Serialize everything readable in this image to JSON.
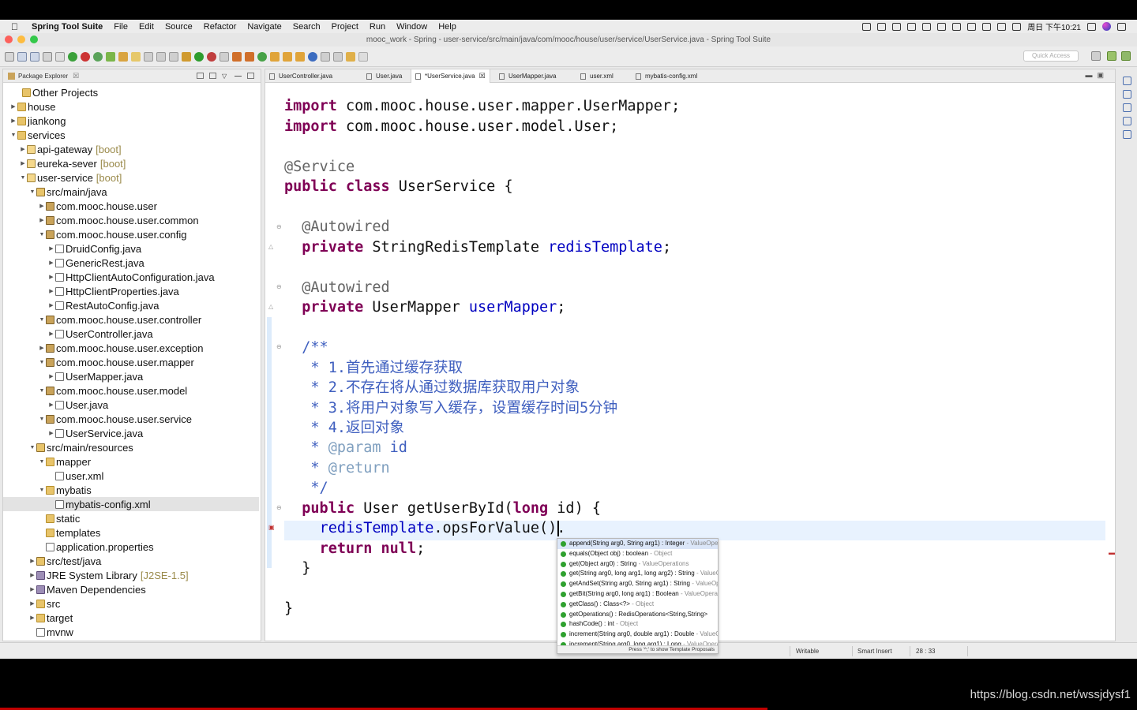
{
  "menubar": {
    "app_name": "Spring Tool Suite",
    "items": [
      "File",
      "Edit",
      "Source",
      "Refactor",
      "Navigate",
      "Search",
      "Project",
      "Run",
      "Window",
      "Help"
    ],
    "clock": "周日 下午10:21"
  },
  "window": {
    "title": "mooc_work - Spring - user-service/src/main/java/com/mooc/house/user/service/UserService.java - Spring Tool Suite"
  },
  "toolbar": {
    "quick_access_placeholder": "Quick Access"
  },
  "package_explorer": {
    "title": "Package Explorer",
    "tree": [
      {
        "label": "Other Projects",
        "deco": "",
        "icon": "folder",
        "twisty": ""
      },
      {
        "label": "house",
        "deco": "",
        "icon": "folder",
        "twisty": "▶"
      },
      {
        "label": "jiankong",
        "deco": "",
        "icon": "folder",
        "twisty": "▶"
      },
      {
        "label": "services",
        "deco": "",
        "icon": "folder",
        "twisty": "▼"
      },
      {
        "label": "api-gateway",
        "deco": "[boot]",
        "icon": "project",
        "twisty": "▶"
      },
      {
        "label": "eureka-sever",
        "deco": "[boot]",
        "icon": "project",
        "twisty": "▶"
      },
      {
        "label": "user-service",
        "deco": "[boot]",
        "icon": "project",
        "twisty": "▼"
      },
      {
        "label": "src/main/java",
        "deco": "",
        "icon": "srcf",
        "twisty": "▼"
      },
      {
        "label": "com.mooc.house.user",
        "deco": "",
        "icon": "package",
        "twisty": "▶"
      },
      {
        "label": "com.mooc.house.user.common",
        "deco": "",
        "icon": "package",
        "twisty": "▶"
      },
      {
        "label": "com.mooc.house.user.config",
        "deco": "",
        "icon": "package",
        "twisty": "▼"
      },
      {
        "label": "DruidConfig.java",
        "deco": "",
        "icon": "java",
        "twisty": "▶"
      },
      {
        "label": "GenericRest.java",
        "deco": "",
        "icon": "java",
        "twisty": "▶"
      },
      {
        "label": "HttpClientAutoConfiguration.java",
        "deco": "",
        "icon": "java",
        "twisty": "▶"
      },
      {
        "label": "HttpClientProperties.java",
        "deco": "",
        "icon": "java",
        "twisty": "▶"
      },
      {
        "label": "RestAutoConfig.java",
        "deco": "",
        "icon": "java",
        "twisty": "▶"
      },
      {
        "label": "com.mooc.house.user.controller",
        "deco": "",
        "icon": "package",
        "twisty": "▼"
      },
      {
        "label": "UserController.java",
        "deco": "",
        "icon": "java",
        "twisty": "▶"
      },
      {
        "label": "com.mooc.house.user.exception",
        "deco": "",
        "icon": "package",
        "twisty": "▶"
      },
      {
        "label": "com.mooc.house.user.mapper",
        "deco": "",
        "icon": "package",
        "twisty": "▼"
      },
      {
        "label": "UserMapper.java",
        "deco": "",
        "icon": "java",
        "twisty": "▶"
      },
      {
        "label": "com.mooc.house.user.model",
        "deco": "",
        "icon": "package",
        "twisty": "▼"
      },
      {
        "label": "User.java",
        "deco": "",
        "icon": "java",
        "twisty": "▶"
      },
      {
        "label": "com.mooc.house.user.service",
        "deco": "",
        "icon": "package",
        "twisty": "▼"
      },
      {
        "label": "UserService.java",
        "deco": "",
        "icon": "java",
        "twisty": "▶"
      },
      {
        "label": "src/main/resources",
        "deco": "",
        "icon": "srcf",
        "twisty": "▼"
      },
      {
        "label": "mapper",
        "deco": "",
        "icon": "folder",
        "twisty": "▼"
      },
      {
        "label": "user.xml",
        "deco": "",
        "icon": "xml",
        "twisty": ""
      },
      {
        "label": "mybatis",
        "deco": "",
        "icon": "folder",
        "twisty": "▼"
      },
      {
        "label": "mybatis-config.xml",
        "deco": "",
        "icon": "xml",
        "twisty": ""
      },
      {
        "label": "static",
        "deco": "",
        "icon": "folder",
        "twisty": ""
      },
      {
        "label": "templates",
        "deco": "",
        "icon": "folder",
        "twisty": ""
      },
      {
        "label": "application.properties",
        "deco": "",
        "icon": "java",
        "twisty": ""
      },
      {
        "label": "src/test/java",
        "deco": "",
        "icon": "srcf",
        "twisty": "▶"
      },
      {
        "label": "JRE System Library",
        "deco": "[J2SE-1.5]",
        "icon": "lib",
        "twisty": "▶"
      },
      {
        "label": "Maven Dependencies",
        "deco": "",
        "icon": "lib",
        "twisty": "▶"
      },
      {
        "label": "src",
        "deco": "",
        "icon": "folder",
        "twisty": "▶"
      },
      {
        "label": "target",
        "deco": "",
        "icon": "folder",
        "twisty": "▶"
      },
      {
        "label": "mvnw",
        "deco": "",
        "icon": "java",
        "twisty": ""
      }
    ]
  },
  "editor": {
    "tabs": [
      {
        "label": "UserController.java",
        "active": false
      },
      {
        "label": "User.java",
        "active": false
      },
      {
        "label": "*UserService.java",
        "active": true
      },
      {
        "label": "UserMapper.java",
        "active": false
      },
      {
        "label": "user.xml",
        "active": false
      },
      {
        "label": "mybatis-config.xml",
        "active": false
      }
    ],
    "code": {
      "import1_kw": "import",
      "import1": " com.mooc.house.user.mapper.UserMapper;",
      "import2_kw": "import",
      "import2": " com.mooc.house.user.model.User;",
      "service_ann": "@Service",
      "class_kw": "public class",
      "class_rest": " UserService {",
      "autowired1": "@Autowired",
      "private1_kw": "private",
      "private1_type": " StringRedisTemplate ",
      "private1_field": "redisTemplate",
      "private1_end": ";",
      "autowired2": "@Autowired",
      "private2_kw": "private",
      "private2_type": " UserMapper ",
      "private2_field": "userMapper",
      "private2_end": ";",
      "jdoc_open": "/**",
      "jdoc1": " * 1.首先通过缓存获取",
      "jdoc2": " * 2.不存在将从通过数据库获取用户对象",
      "jdoc3": " * 3.将用户对象写入缓存，设置缓存时间5分钟",
      "jdoc4": " * 4.返回对象",
      "jdoc_param_star": " * ",
      "jdoc_param_tag": "@param",
      "jdoc_param_name": " id",
      "jdoc_return_star": " * ",
      "jdoc_return_tag": "@return",
      "jdoc_close": " */",
      "method_kw": "public",
      "method_rest": " User getUserById(",
      "method_kw2": "long",
      "method_end": " id) {",
      "call_field": "redisTemplate",
      "call_rest": ".opsForValue().",
      "return_kw": "return",
      "return_val": " null",
      "return_end": ";",
      "close_method": "}",
      "close_class": "}"
    }
  },
  "content_assist": {
    "items": [
      {
        "sig": "append(String arg0, String arg1) : Integer",
        "owner": " - ValueOperations"
      },
      {
        "sig": "equals(Object obj) : boolean",
        "owner": " - Object"
      },
      {
        "sig": "get(Object arg0) : String",
        "owner": " - ValueOperations"
      },
      {
        "sig": "get(String arg0, long arg1, long arg2) : String",
        "owner": " - ValueOperations"
      },
      {
        "sig": "getAndSet(String arg0, String arg1) : String",
        "owner": " - ValueOperations"
      },
      {
        "sig": "getBit(String arg0, long arg1) : Boolean",
        "owner": " - ValueOperations"
      },
      {
        "sig": "getClass() : Class<?>",
        "owner": " - Object"
      },
      {
        "sig": "getOperations() : RedisOperations<String,String>",
        "owner": ""
      },
      {
        "sig": "hashCode() : int",
        "owner": " - Object"
      },
      {
        "sig": "increment(String arg0, double arg1) : Double",
        "owner": " - ValueOperations"
      },
      {
        "sig": "increment(String arg0, long arg1) : Long",
        "owner": " - ValueOperations"
      }
    ],
    "hint": "Press '^;' to show Template Proposals"
  },
  "statusbar": {
    "writable": "Writable",
    "insert_mode": "Smart Insert",
    "position": "28 : 33"
  },
  "watermark": "https://blog.csdn.net/wssjdysf1",
  "colors": {
    "keyword": "#7f0055",
    "field": "#0000c0",
    "annotation": "#646464",
    "javadoc": "#3f5fbf",
    "current_line": "#e8f2fe"
  }
}
